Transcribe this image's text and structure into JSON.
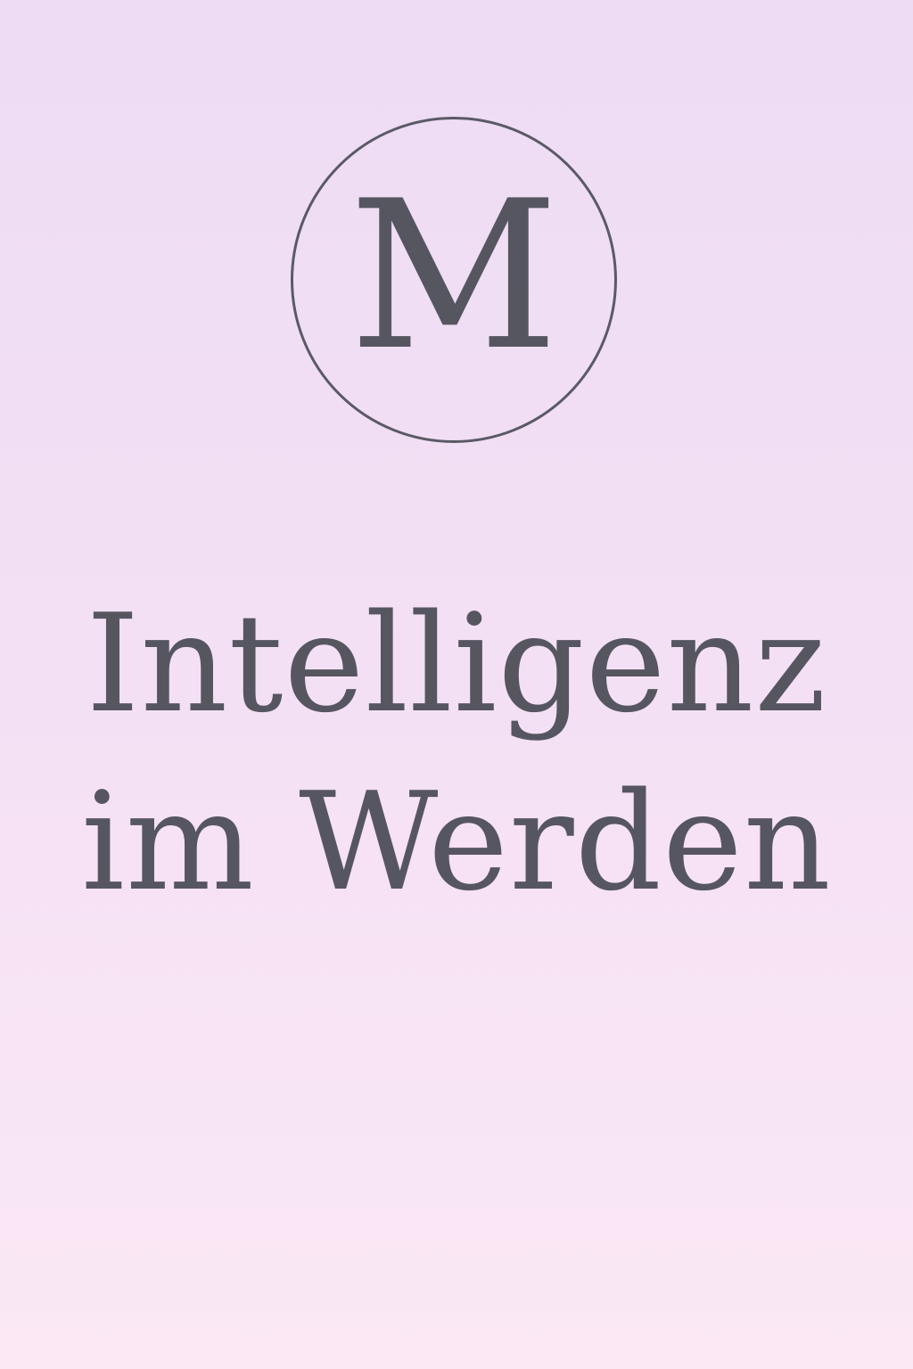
{
  "logo": {
    "letter": "M"
  },
  "title": {
    "line1": "Intelligenz",
    "line2": "im Werden"
  },
  "colors": {
    "text": "#565661",
    "background_top": "#eddcf4",
    "background_bottom": "#fbe8f4"
  }
}
